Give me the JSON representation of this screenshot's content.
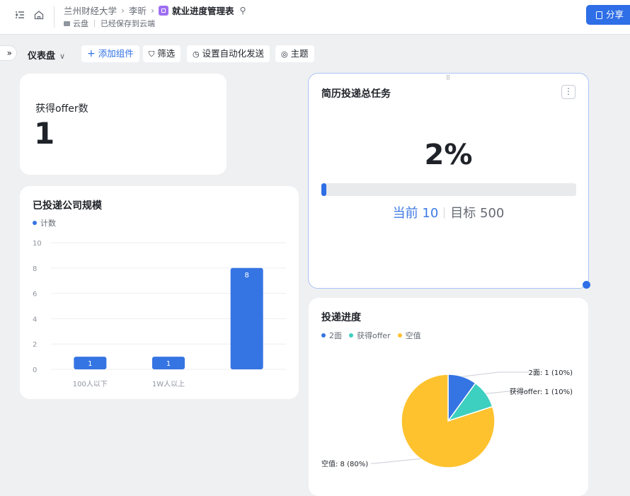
{
  "topbar": {
    "breadcrumb": [
      "兰州财经大学",
      "李昕",
      "就业进度管理表"
    ],
    "location": "云盘",
    "save_status": "已经保存到云端",
    "share_label": "分享"
  },
  "toolbar": {
    "dashboard_label": "仪表盘",
    "add_component": "添加组件",
    "filter": "筛选",
    "automation": "设置自动化发送",
    "theme": "主题",
    "collapse_glyph": "»"
  },
  "offer_card": {
    "label": "获得offer数",
    "value": "1"
  },
  "progress_card": {
    "title": "简历投递总任务",
    "percent_label": "2%",
    "fill_fraction": 0.02,
    "current_label": "当前 10",
    "target_label": "目标 500"
  },
  "company_card": {
    "title": "已投递公司规模",
    "legend": "计数"
  },
  "delivery_card": {
    "title": "投递进度"
  },
  "colors": {
    "accent": "#2e6ee6",
    "bar": "#3574e3",
    "pie_2nd": "#3574e3",
    "pie_offer": "#3dcfbf",
    "pie_empty": "#fdc22e"
  },
  "chart_data": [
    {
      "type": "bar",
      "title": "已投递公司规模",
      "categories": [
        "100人以下",
        "1W人以上",
        ""
      ],
      "series": [
        {
          "name": "计数",
          "values": [
            1,
            1,
            8
          ]
        }
      ],
      "ylim": [
        0,
        10
      ],
      "yticks": [
        0,
        2,
        4,
        6,
        8,
        10
      ],
      "grid": true,
      "legend": "top-left"
    },
    {
      "type": "pie",
      "title": "投递进度",
      "slices": [
        {
          "name": "2面",
          "value": 1,
          "label": "2面: 1 (10%)",
          "color": "#3574e3"
        },
        {
          "name": "获得offer",
          "value": 1,
          "label": "获得offer: 1 (10%)",
          "color": "#3dcfbf"
        },
        {
          "name": "空值",
          "value": 8,
          "label": "空值: 8 (80%)",
          "color": "#fdc22e"
        }
      ],
      "legend": "top-left"
    }
  ]
}
